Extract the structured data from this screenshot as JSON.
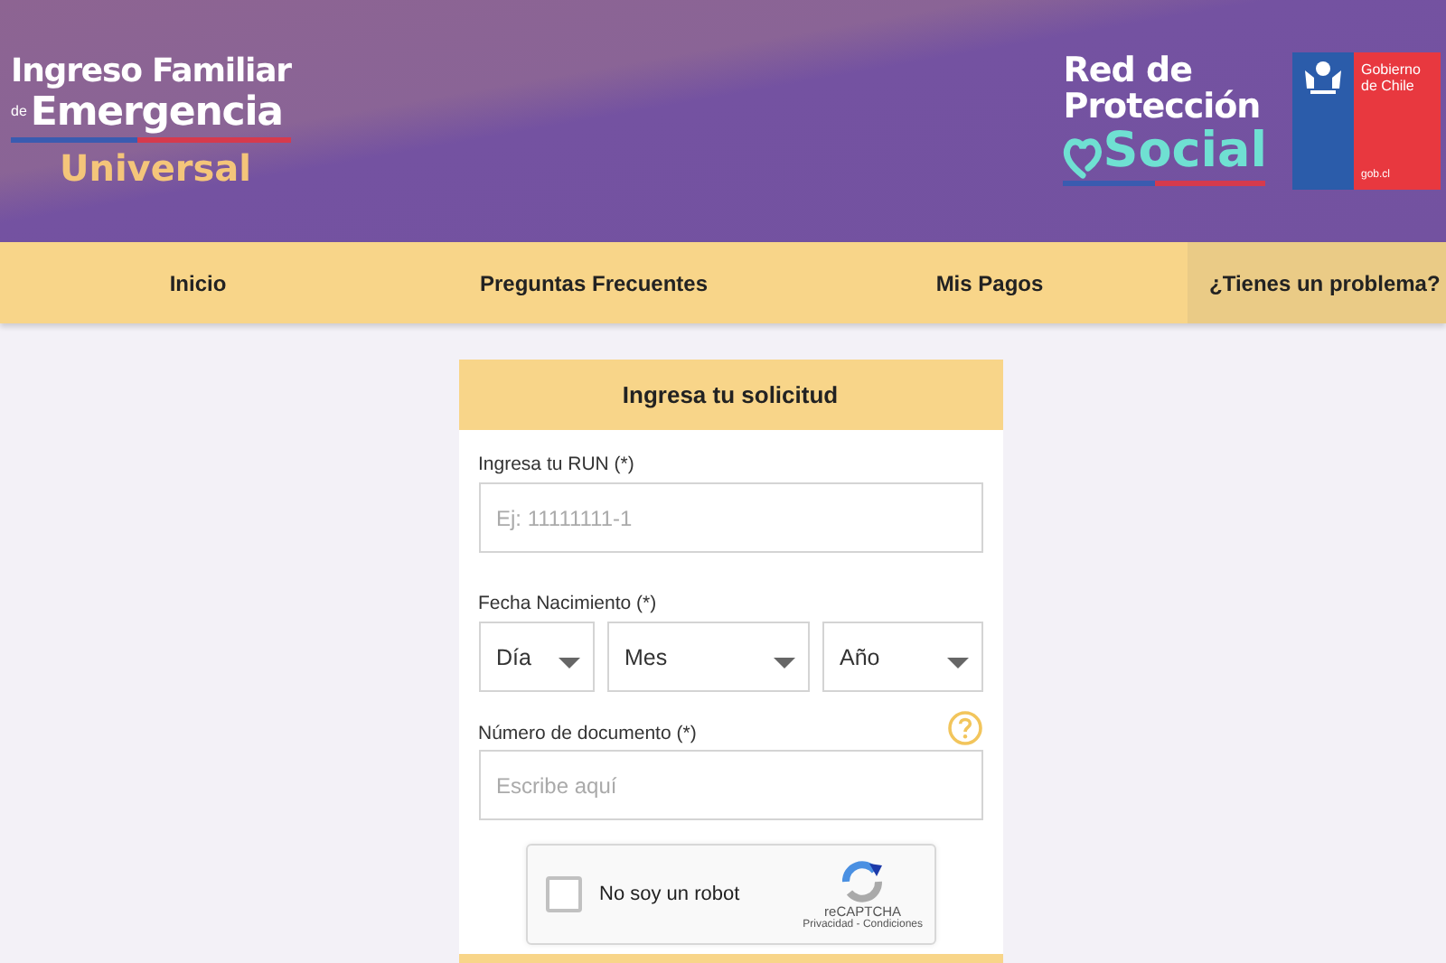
{
  "header": {
    "logo_left": {
      "line_1": "Ingreso Familiar",
      "small": "de",
      "line_2": "Emergencia",
      "line_3": "Universal"
    },
    "logo_right": {
      "line_1": "Red de",
      "line_2": "Protección",
      "line_3": "Social"
    },
    "gov_logo": {
      "name": "Gobierno de Chile",
      "site": "gob.cl"
    }
  },
  "nav": [
    {
      "label": "Inicio",
      "kind": "link"
    },
    {
      "label": "Preguntas Frecuentes",
      "kind": "link"
    },
    {
      "label": "Mis Pagos",
      "kind": "link"
    },
    {
      "label": "¿Tienes un problema?",
      "kind": "help"
    }
  ],
  "form": {
    "title": "Ingresa tu solicitud",
    "run": {
      "label": "Ingresa tu RUN",
      "required": "(*)",
      "placeholder": "Ej: 11111111-1"
    },
    "birth": {
      "label": "Fecha Nacimiento",
      "required": "(*)",
      "selects": [
        {
          "value": "Día"
        },
        {
          "value": "Mes"
        },
        {
          "value": "Año"
        }
      ]
    },
    "document": {
      "label": "Número de documento",
      "required": "(*)",
      "placeholder": "Escribe aquí"
    },
    "captcha": {
      "label": "No soy un robot",
      "checked": false,
      "brand": "reCAPTCHA",
      "links": "Privacidad - Condiciones"
    }
  }
}
